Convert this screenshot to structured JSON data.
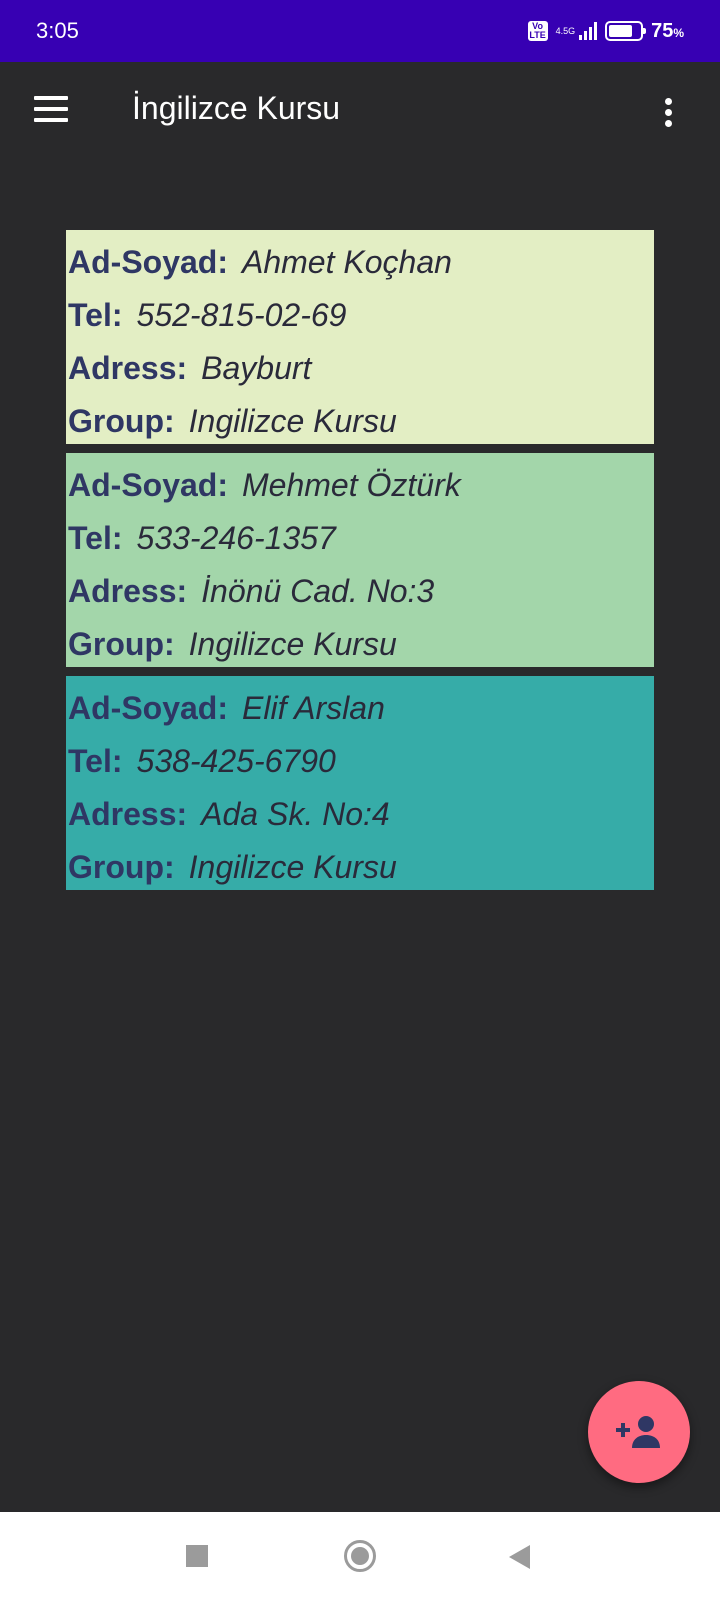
{
  "status_bar": {
    "time": "3:05",
    "volte_top": "Vo",
    "volte_bottom": "LTE",
    "network": "4.5G",
    "battery_percent": "75",
    "battery_unit": "%",
    "battery_level": 0.75
  },
  "app_bar": {
    "title": "İngilizce Kursu",
    "menu_icon": "hamburger-menu-icon",
    "more_icon": "more-vertical-icon"
  },
  "labels": {
    "name": "Ad-Soyad:",
    "tel": "Tel:",
    "address": "Adress:",
    "group": "Group:"
  },
  "students": [
    {
      "name": "Ahmet Koçhan",
      "tel": "552-815-02-69",
      "address": "Bayburt",
      "group": "Ingilizce Kursu",
      "color": "#e3eec4"
    },
    {
      "name": "Mehmet Öztürk",
      "tel": "533-246-1357",
      "address": "İnönü Cad. No:3",
      "group": "Ingilizce Kursu",
      "color": "#a3d6aa"
    },
    {
      "name": "Elif Arslan",
      "tel": "538-425-6790",
      "address": "Ada Sk. No:4",
      "group": "Ingilizce Kursu",
      "color": "#36aca8"
    }
  ],
  "fab": {
    "icon": "add-person-icon",
    "color": "#ff6b81"
  },
  "nav_bar": {
    "icons": [
      "recents-square-icon",
      "home-circle-icon",
      "back-triangle-icon"
    ]
  }
}
